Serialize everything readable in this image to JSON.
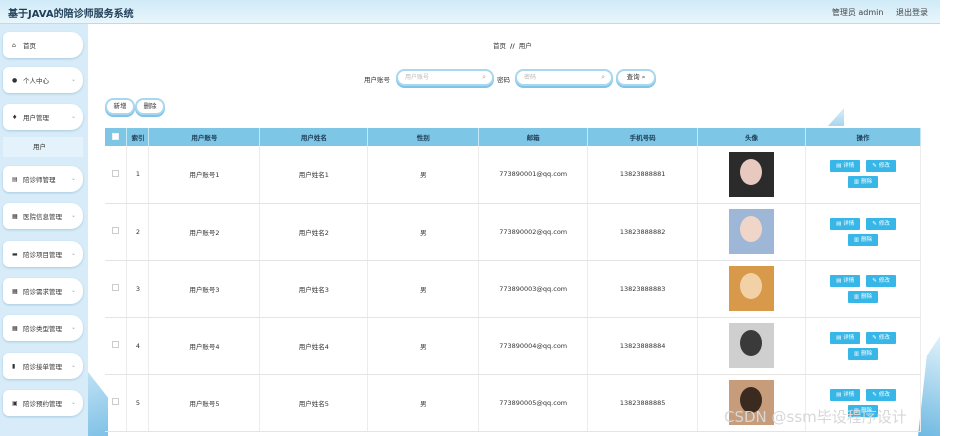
{
  "header": {
    "title": "基于JAVA的陪诊师服务系统",
    "user": "管理员 admin",
    "logout": "退出登录"
  },
  "sidebar": {
    "items": [
      {
        "label": "首页",
        "icon": "home-icon",
        "glyph": "⌂"
      },
      {
        "label": "个人中心",
        "icon": "person-icon",
        "glyph": "●"
      },
      {
        "label": "用户管理",
        "icon": "user-pin-icon",
        "glyph": "♦"
      },
      {
        "label": "陪诊师管理",
        "icon": "card-icon",
        "glyph": "▤"
      },
      {
        "label": "医院信息管理",
        "icon": "grid-icon",
        "glyph": "▦"
      },
      {
        "label": "陪诊项目管理",
        "icon": "ticket-icon",
        "glyph": "▬"
      },
      {
        "label": "陪诊需求管理",
        "icon": "grid-icon",
        "glyph": "▦"
      },
      {
        "label": "陪诊类型管理",
        "icon": "grid-icon",
        "glyph": "▦"
      },
      {
        "label": "陪诊接单管理",
        "icon": "bar-chart-icon",
        "glyph": "▮"
      },
      {
        "label": "陪诊预约管理",
        "icon": "briefcase-icon",
        "glyph": "▣"
      }
    ],
    "sub_item": "用户"
  },
  "breadcrumb": {
    "home": "首页",
    "separator": "//",
    "current": "用户"
  },
  "search": {
    "account_label": "用户账号",
    "account_placeholder": "用户账号",
    "password_label": "密码",
    "password_placeholder": "密码",
    "query_button": "查询"
  },
  "toolbar": {
    "add_label": "新增",
    "delete_label": "删除"
  },
  "table": {
    "columns": [
      "索引",
      "用户账号",
      "用户姓名",
      "性别",
      "邮箱",
      "手机号码",
      "头像",
      "操作"
    ],
    "rows": [
      {
        "index": "1",
        "account": "用户账号1",
        "name": "用户姓名1",
        "gender": "男",
        "email": "773890001@qq.com",
        "phone": "13823888881"
      },
      {
        "index": "2",
        "account": "用户账号2",
        "name": "用户姓名2",
        "gender": "男",
        "email": "773890002@qq.com",
        "phone": "13823888882"
      },
      {
        "index": "3",
        "account": "用户账号3",
        "name": "用户姓名3",
        "gender": "男",
        "email": "773890003@qq.com",
        "phone": "13823888883"
      },
      {
        "index": "4",
        "account": "用户账号4",
        "name": "用户姓名4",
        "gender": "男",
        "email": "773890004@qq.com",
        "phone": "13823888884"
      },
      {
        "index": "5",
        "account": "用户账号5",
        "name": "用户姓名5",
        "gender": "男",
        "email": "773890005@qq.com",
        "phone": "13823888885"
      }
    ],
    "actions": {
      "detail": "详情",
      "edit": "修改",
      "delete": "删除"
    }
  },
  "watermark": "CSDN @ssm毕设程序设计",
  "colors": {
    "accent": "#37b6e8",
    "header_bg": "#cfeaf7",
    "table_header": "#7dc6e6",
    "sidebar_bg": "#d7ecf8"
  }
}
